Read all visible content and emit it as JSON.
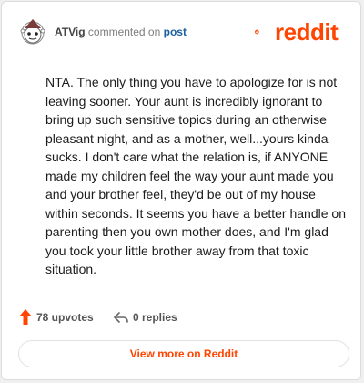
{
  "header": {
    "author": "ATVig",
    "commented_text": "commented on",
    "post_link": "post",
    "logo_text": "reddit",
    "avatar_icon": "snoo-avatar-icon",
    "logo_icon": "reddit-alien-icon"
  },
  "comment": {
    "body": "NTA. The only thing you have to apologize for is not leaving sooner. Your aunt is incredibly ignorant to bring up such sensitive topics during an otherwise pleasant night, and as a mother, well...yours kinda sucks. I don't care what the relation is, if ANYONE made my children feel the way your aunt made you and your brother feel, they'd be out of my house within seconds. It seems you have a better handle on parenting then you own mother does, and I'm glad you took your little brother away from that toxic situation."
  },
  "actions": {
    "upvotes": "78 upvotes",
    "replies": "0 replies",
    "upvote_icon": "upvote-arrow-icon",
    "reply_icon": "reply-arrow-icon"
  },
  "footer": {
    "view_more": "View more on Reddit"
  },
  "colors": {
    "brand": "#ff4500",
    "link": "#1c5f9e",
    "text": "#1c1c1c",
    "muted": "#7c7c7c"
  }
}
